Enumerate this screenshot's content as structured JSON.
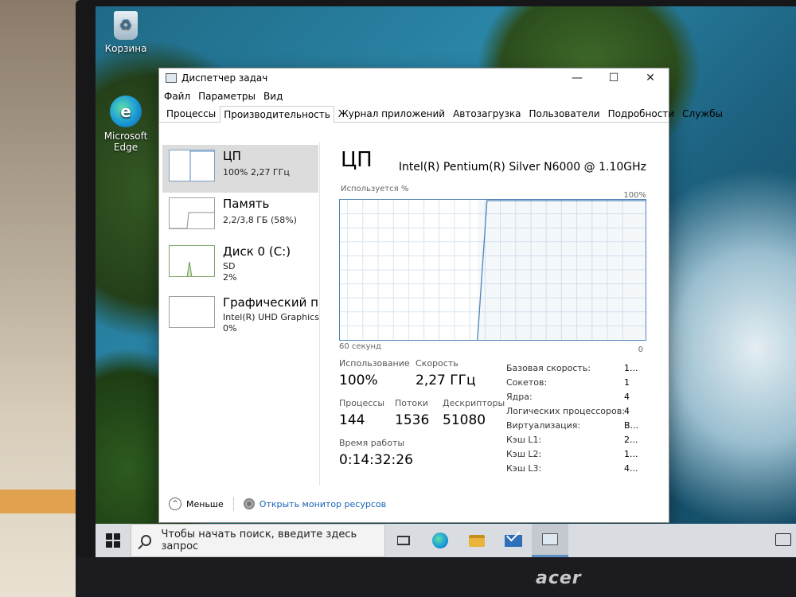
{
  "desktop": {
    "icons": [
      {
        "label": "Корзина",
        "icon": "recycle-bin-icon"
      },
      {
        "label": "Microsoft Edge",
        "icon": "edge-icon"
      }
    ]
  },
  "window": {
    "title": "Диспетчер задач",
    "controls": {
      "minimize": "—",
      "maximize": "☐",
      "close": "✕"
    }
  },
  "menu": [
    "Файл",
    "Параметры",
    "Вид"
  ],
  "tabs": [
    "Процессы",
    "Производительность",
    "Журнал приложений",
    "Автозагрузка",
    "Пользователи",
    "Подробности",
    "Службы"
  ],
  "active_tab": "Производительность",
  "resources": [
    {
      "title": "ЦП",
      "line1": "100%  2,27 ГГц",
      "line2": ""
    },
    {
      "title": "Память",
      "line1": "2,2/3,8 ГБ (58%)",
      "line2": ""
    },
    {
      "title": "Диск 0 (C:)",
      "line1": "SD",
      "line2": "2%"
    },
    {
      "title": "Графический прс",
      "line1": "Intel(R) UHD Graphics",
      "line2": "0%"
    }
  ],
  "cpu": {
    "title": "ЦП",
    "model": "Intel(R) Pentium(R) Silver N6000 @ 1.10GHz",
    "graph_label": "Используется %",
    "graph_max": "100%",
    "graph_time": "60 секунд",
    "graph_min": "0",
    "usage_fraction_history": {
      "from_seconds_ago": 33,
      "value_percent": 100
    },
    "usage_label": "Использование",
    "usage_value": "100%",
    "speed_label": "Скорость",
    "speed_value": "2,27 ГГц",
    "processes_label": "Процессы",
    "processes_value": "144",
    "threads_label": "Потоки",
    "threads_value": "1536",
    "handles_label": "Дескрипторы",
    "handles_value": "51080",
    "uptime_label": "Время работы",
    "uptime_value": "0:14:32:26",
    "details": [
      {
        "key": "Базовая скорость:",
        "value": "1..."
      },
      {
        "key": "Сокетов:",
        "value": "1"
      },
      {
        "key": "Ядра:",
        "value": "4"
      },
      {
        "key": "Логических процессоров:",
        "value": "4"
      },
      {
        "key": "Виртуализация:",
        "value": "В..."
      },
      {
        "key": "Кэш L1:",
        "value": "2..."
      },
      {
        "key": "Кэш L2:",
        "value": "1..."
      },
      {
        "key": "Кэш L3:",
        "value": "4..."
      }
    ]
  },
  "footer": {
    "less": "Меньше",
    "resource_monitor": "Открыть монитор ресурсов"
  },
  "taskbar": {
    "search_placeholder": "Чтобы начать поиск, введите здесь запрос"
  },
  "bezel": {
    "brand": "acer"
  },
  "colors": {
    "graph_line": "#4f84b8",
    "grid": "#d9e5f0",
    "selected": "#cfe3f3"
  }
}
